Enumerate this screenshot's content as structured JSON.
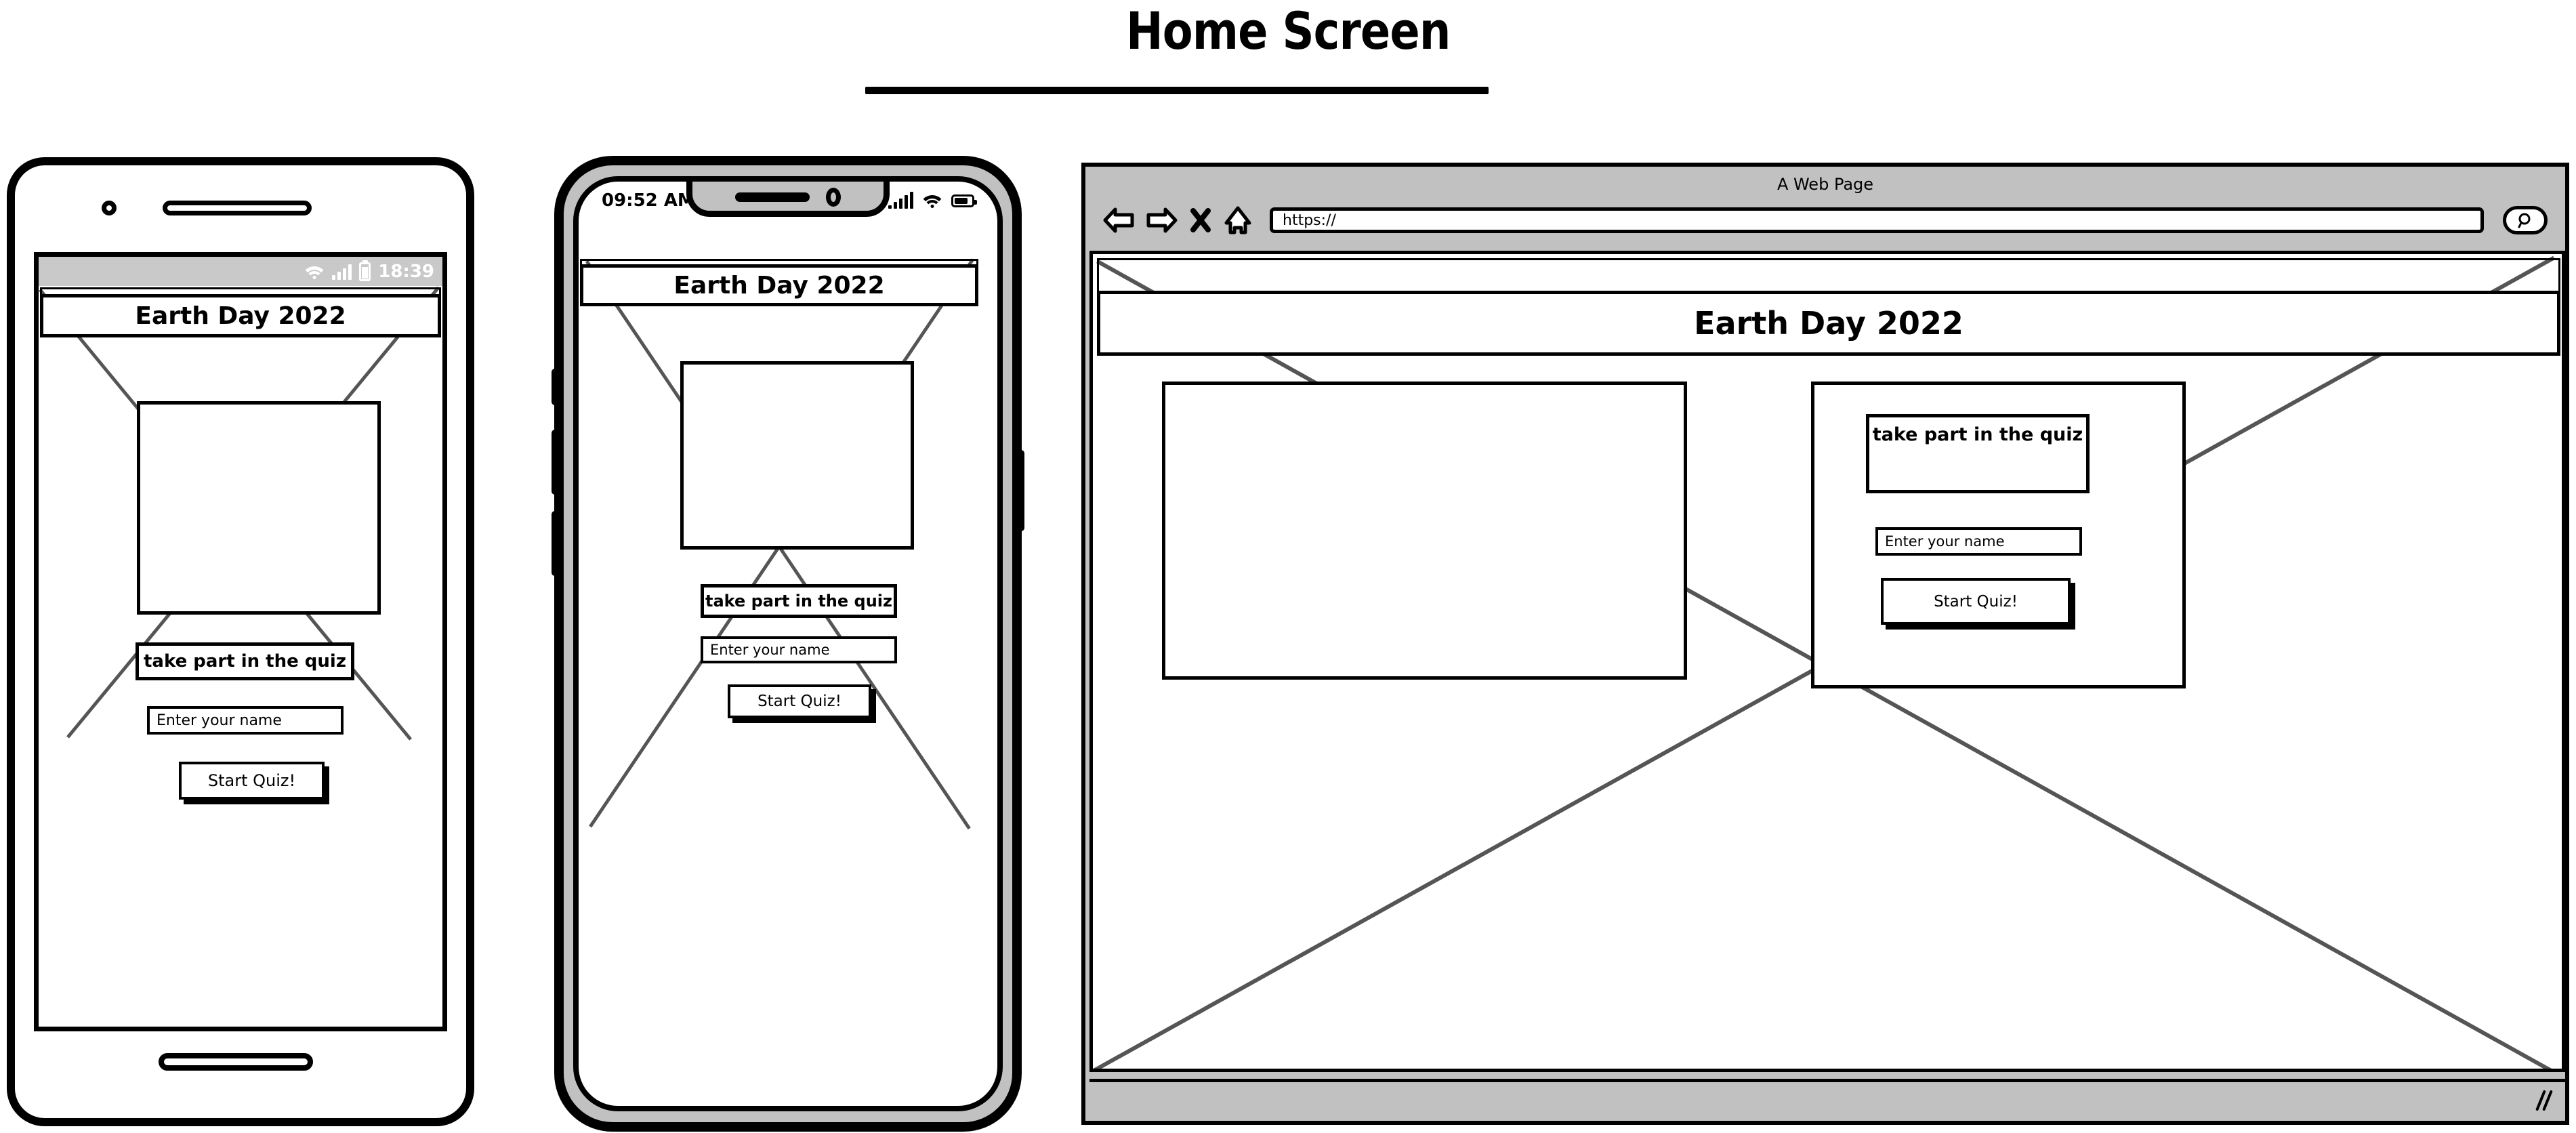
{
  "page": {
    "title": "Home Screen"
  },
  "android": {
    "statusbar": {
      "time": "18:39",
      "icons": [
        "wifi-icon",
        "signal-icon",
        "battery-icon"
      ]
    },
    "app": {
      "header": "Earth Day 2022",
      "quiz_heading": "take part in the quiz",
      "name_placeholder": "Enter your name",
      "start_button": "Start Quiz!"
    }
  },
  "iphone": {
    "statusbar": {
      "time": "09:52 AM",
      "icons": [
        "signal-icon",
        "wifi-icon",
        "battery-icon"
      ]
    },
    "app": {
      "header": "Earth Day 2022",
      "quiz_heading": "take part in the quiz",
      "name_placeholder": "Enter your name",
      "start_button": "Start Quiz!"
    }
  },
  "browser": {
    "window_title": "A Web Page",
    "url": "https://",
    "toolbar_icons": [
      "back-arrow-icon",
      "forward-arrow-icon",
      "stop-x-icon",
      "home-icon",
      "search-icon"
    ],
    "page": {
      "header": "Earth Day 2022",
      "quiz_heading": "take part in the quiz",
      "name_placeholder": "Enter your name",
      "start_button": "Start Quiz!"
    }
  },
  "colors": {
    "ink": "#000000",
    "chrome_gray": "#c1c1c1",
    "status_gray": "#c9c9c9",
    "diagonal_gray": "#555555"
  }
}
